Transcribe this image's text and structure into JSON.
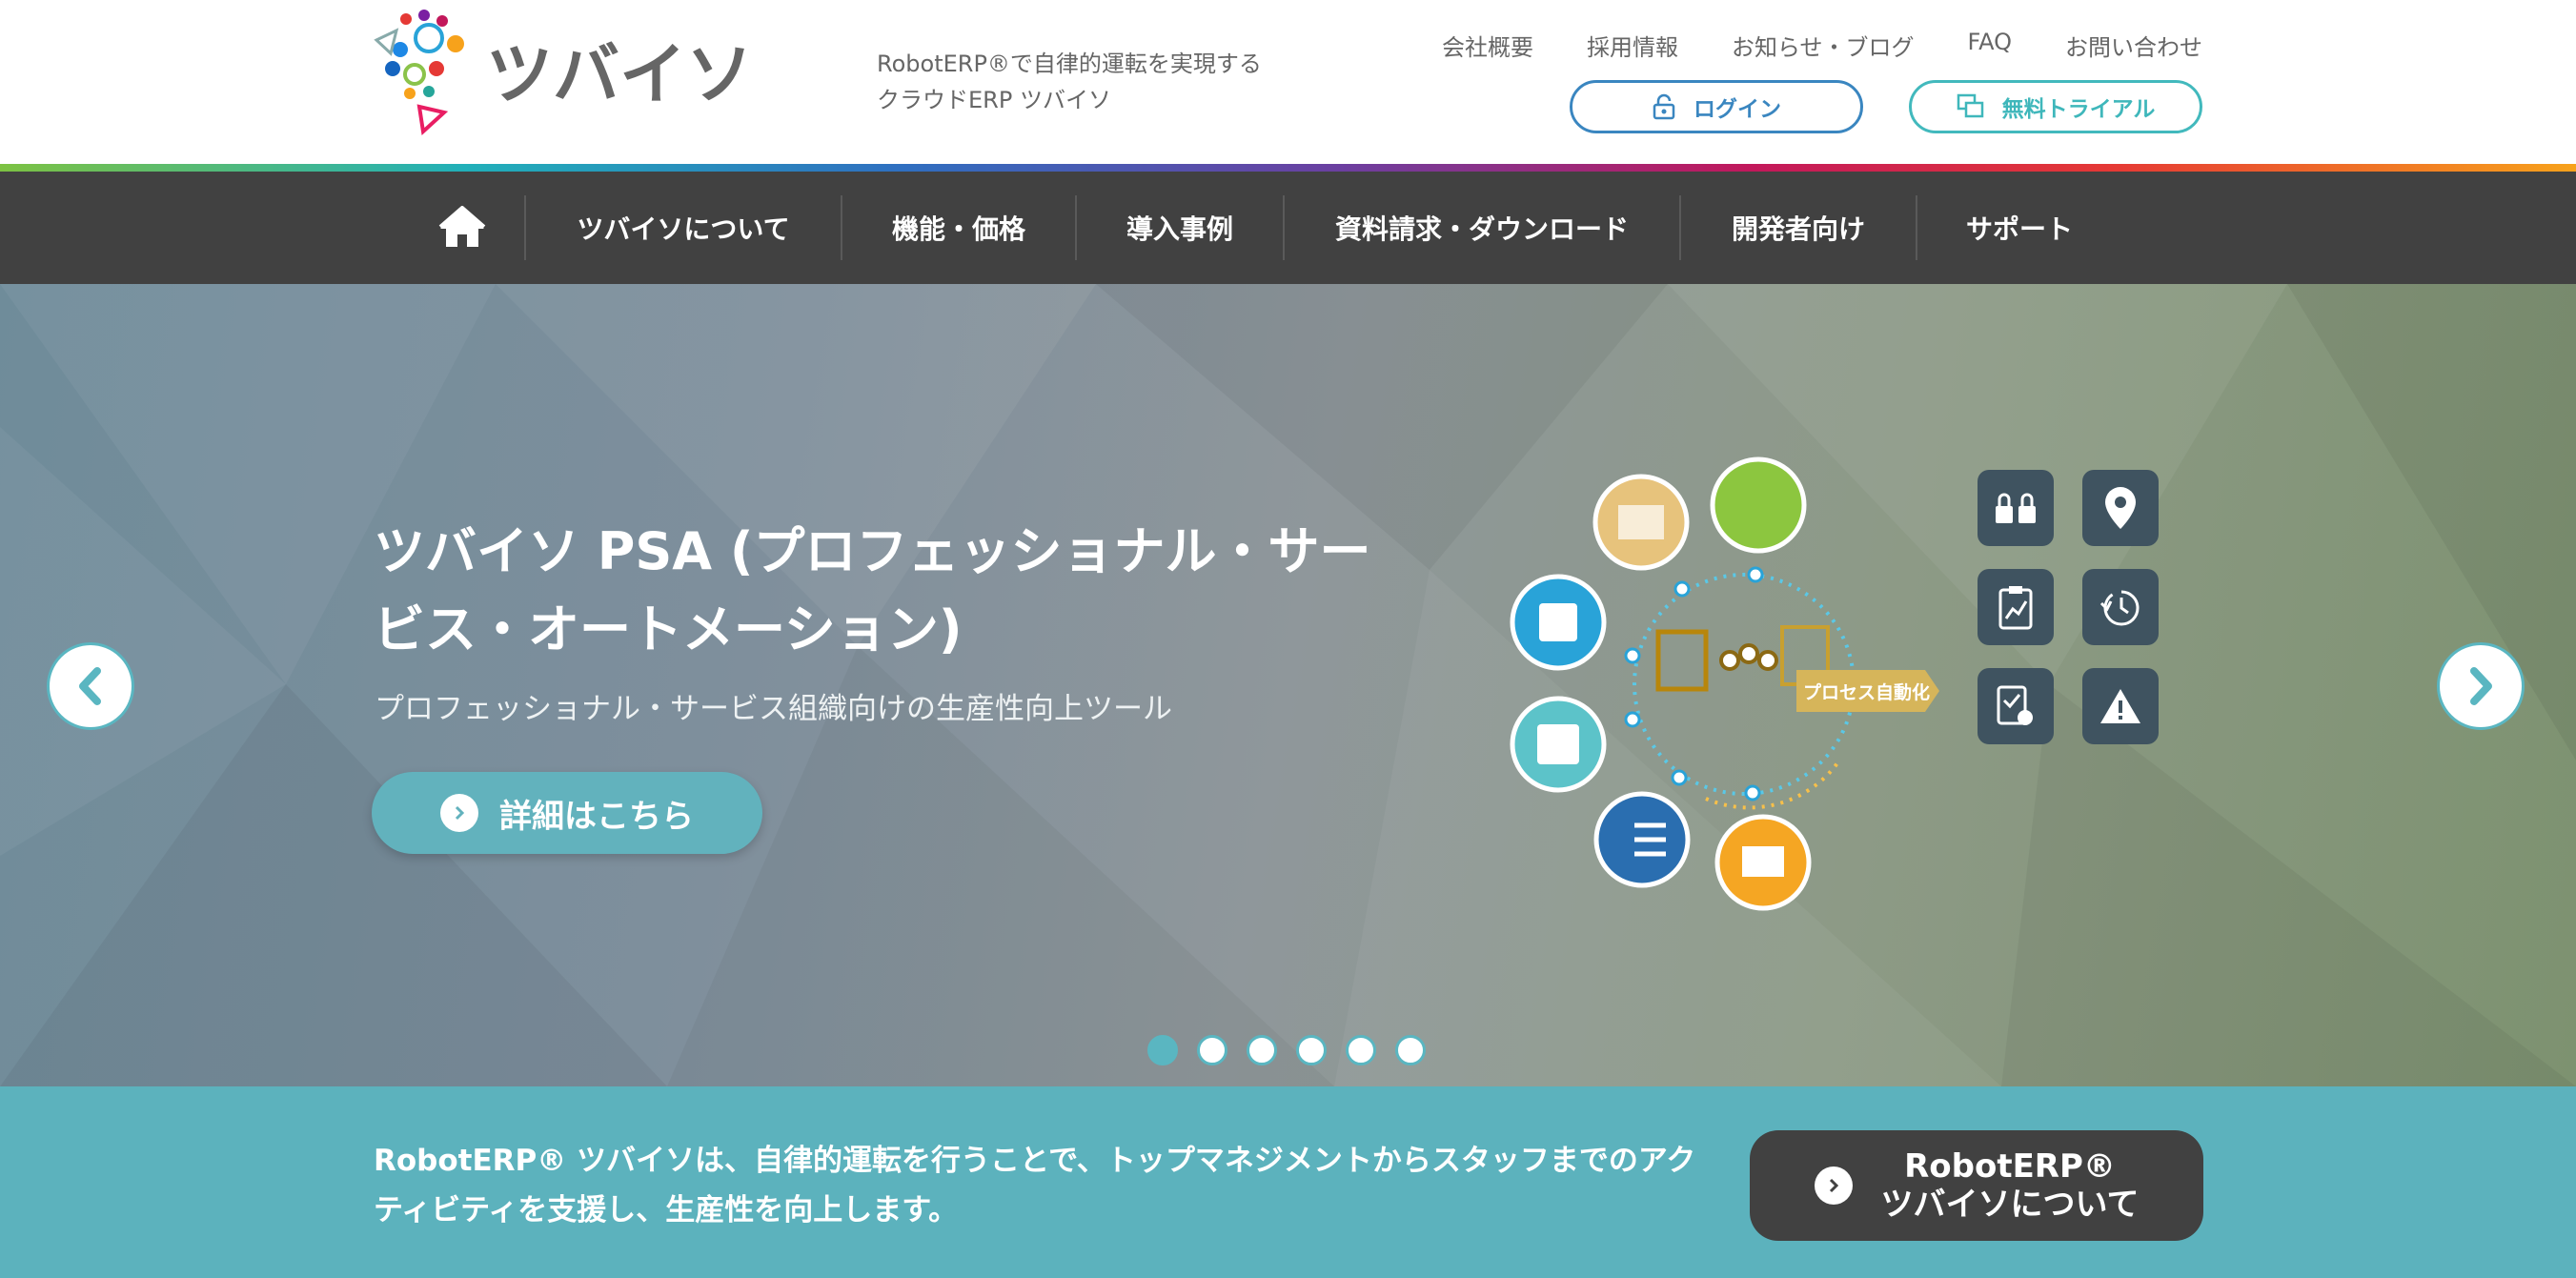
{
  "header": {
    "logo_text": "ツバイソ",
    "tagline_line1": "RobotERP®で自律的運転を実現する",
    "tagline_line2": "クラウドERP ツバイソ",
    "top_links": [
      "会社概要",
      "採用情報",
      "お知らせ・ブログ",
      "FAQ",
      "お問い合わせ"
    ],
    "login_label": "ログイン",
    "trial_label": "無料トライアル"
  },
  "nav": {
    "items": [
      "ツバイソについて",
      "機能・価格",
      "導入事例",
      "資料請求・ダウンロード",
      "開発者向け",
      "サポート"
    ]
  },
  "hero": {
    "title": "ツバイソ PSA (プロフェッショナル・サービス・オートメーション)",
    "subtitle": "プロフェッショナル・サービス組織向けの生産性向上ツール",
    "detail_button": "詳細はこちら",
    "illustration_tag": "プロセス自動化",
    "slide_count": 6,
    "active_slide": 1
  },
  "band": {
    "text": "RobotERP® ツバイソは、自律的運転を行うことで、トップマネジメントからスタッフまでのアクティビティを支援し、生産性を向上します。",
    "about_button_line1": "RobotERP®",
    "about_button_line2": "ツバイソについて"
  },
  "colors": {
    "accent": "#5cb2bd",
    "nav_bg": "#414141",
    "login_blue": "#3a86c0",
    "trial_teal": "#42b9bd"
  },
  "icons": [
    "home-icon",
    "lock-icon",
    "windows-icon",
    "chevron-left-icon",
    "chevron-right-icon",
    "chevron-right-circle-icon"
  ]
}
